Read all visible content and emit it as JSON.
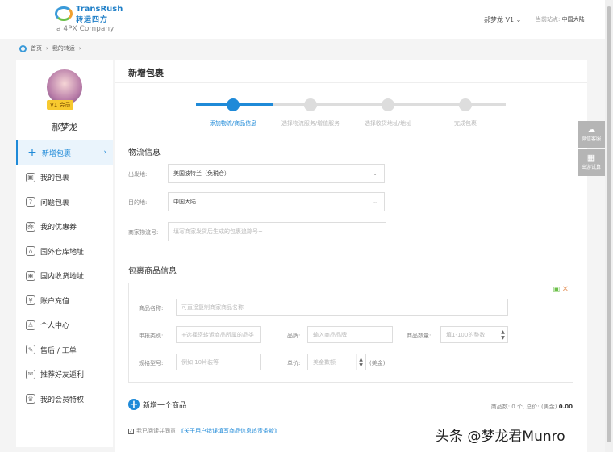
{
  "header": {
    "brand_en": "TransRush",
    "brand_cn": "转运四方",
    "brand_sub": "a 4PX Company",
    "user": "郝梦龙 V1",
    "user_caret": "⌄",
    "site_label": "当前站点:",
    "site_value": "中国大陆"
  },
  "breadcrumb": [
    "首页",
    "我的转运"
  ],
  "sidebar": {
    "vip": "V1 会员",
    "username": "郝梦龙",
    "items": [
      {
        "label": "新增包裹",
        "icon": "plus-icon",
        "glyph": "+",
        "active": true
      },
      {
        "label": "我的包裹",
        "icon": "package-icon",
        "glyph": "▣"
      },
      {
        "label": "问题包裹",
        "icon": "question-icon",
        "glyph": "?"
      },
      {
        "label": "我的优惠券",
        "icon": "coupon-icon",
        "glyph": "券"
      },
      {
        "label": "国外仓库地址",
        "icon": "warehouse-icon",
        "glyph": "⌂"
      },
      {
        "label": "国内收货地址",
        "icon": "location-icon",
        "glyph": "◉"
      },
      {
        "label": "账户充值",
        "icon": "recharge-icon",
        "glyph": "¥"
      },
      {
        "label": "个人中心",
        "icon": "user-icon",
        "glyph": "♙"
      },
      {
        "label": "售后 / 工单",
        "icon": "wrench-icon",
        "glyph": "✎"
      },
      {
        "label": "推荐好友返利",
        "icon": "gift-icon",
        "glyph": "✉"
      },
      {
        "label": "我的会员特权",
        "icon": "vip-icon",
        "glyph": "♛"
      }
    ]
  },
  "main": {
    "title": "新增包裹",
    "steps": [
      "添加物流/商品信息",
      "选择物流服务/增值服务",
      "选择收货地址/地址",
      "完成包裹"
    ],
    "logistics": {
      "title": "物流信息",
      "origin_label": "出发地:",
      "origin_value": "美国波特兰（免税仓）",
      "dest_label": "目的地:",
      "dest_value": "中国大陆",
      "tracking_label": "商家物流号:",
      "tracking_placeholder": "填写商家发货后生成的包裹追踪号~"
    },
    "goods": {
      "title": "包裹商品信息",
      "name_label": "商品名称:",
      "name_placeholder": "可直接复制商家商品名称",
      "category_label": "申报类别:",
      "category_placeholder": "+选择您转运商品所属的品类",
      "brand_label": "品牌:",
      "brand_placeholder": "输入商品品牌",
      "qty_label": "商品数量:",
      "qty_placeholder": "填1-100的整数",
      "spec_label": "规格型号:",
      "spec_placeholder": "例如 10片装等",
      "price_label": "单价:",
      "price_placeholder": "美金数额",
      "price_unit": "(美金)"
    },
    "add_goods": "新增一个商品",
    "summary_prefix": "商品数: 0 个, 总价: (美金)",
    "summary_total": "0.00",
    "agree_text": "我已阅读并同意",
    "agree_link": "《关于用户错误填写商品信息追责条款》"
  },
  "float": {
    "wechat": "微信客服",
    "qr": "出游试算"
  },
  "watermark": "头条 @梦龙君Munro",
  "colors": {
    "accent": "#1f8ad8"
  }
}
